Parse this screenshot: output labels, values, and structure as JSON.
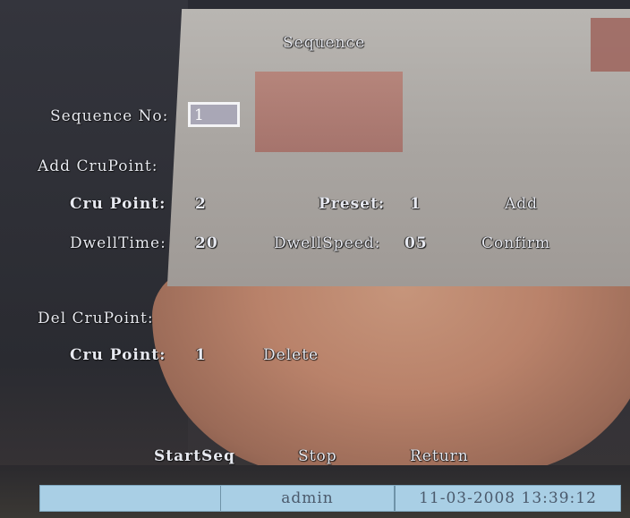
{
  "title": "Sequence",
  "sequence_no": {
    "label": "Sequence No:",
    "value": "1"
  },
  "add_section": {
    "label": "Add CruPoint:",
    "cru_point_label": "Cru Point:",
    "cru_point_value": "2",
    "preset_label": "Preset:",
    "preset_value": "1",
    "add_button": "Add",
    "dwell_time_label": "DwellTime:",
    "dwell_time_value": "20",
    "dwell_speed_label": "DwellSpeed:",
    "dwell_speed_value": "05",
    "confirm_button": "Confirm"
  },
  "del_section": {
    "label": "Del CruPoint:",
    "cru_point_label": "Cru Point:",
    "cru_point_value": "1",
    "delete_button": "Delete"
  },
  "footer_buttons": {
    "start": "StartSeq",
    "stop": "Stop",
    "return": "Return"
  },
  "status_bar": {
    "user": "admin",
    "datetime": "11-03-2008 13:39:12"
  }
}
